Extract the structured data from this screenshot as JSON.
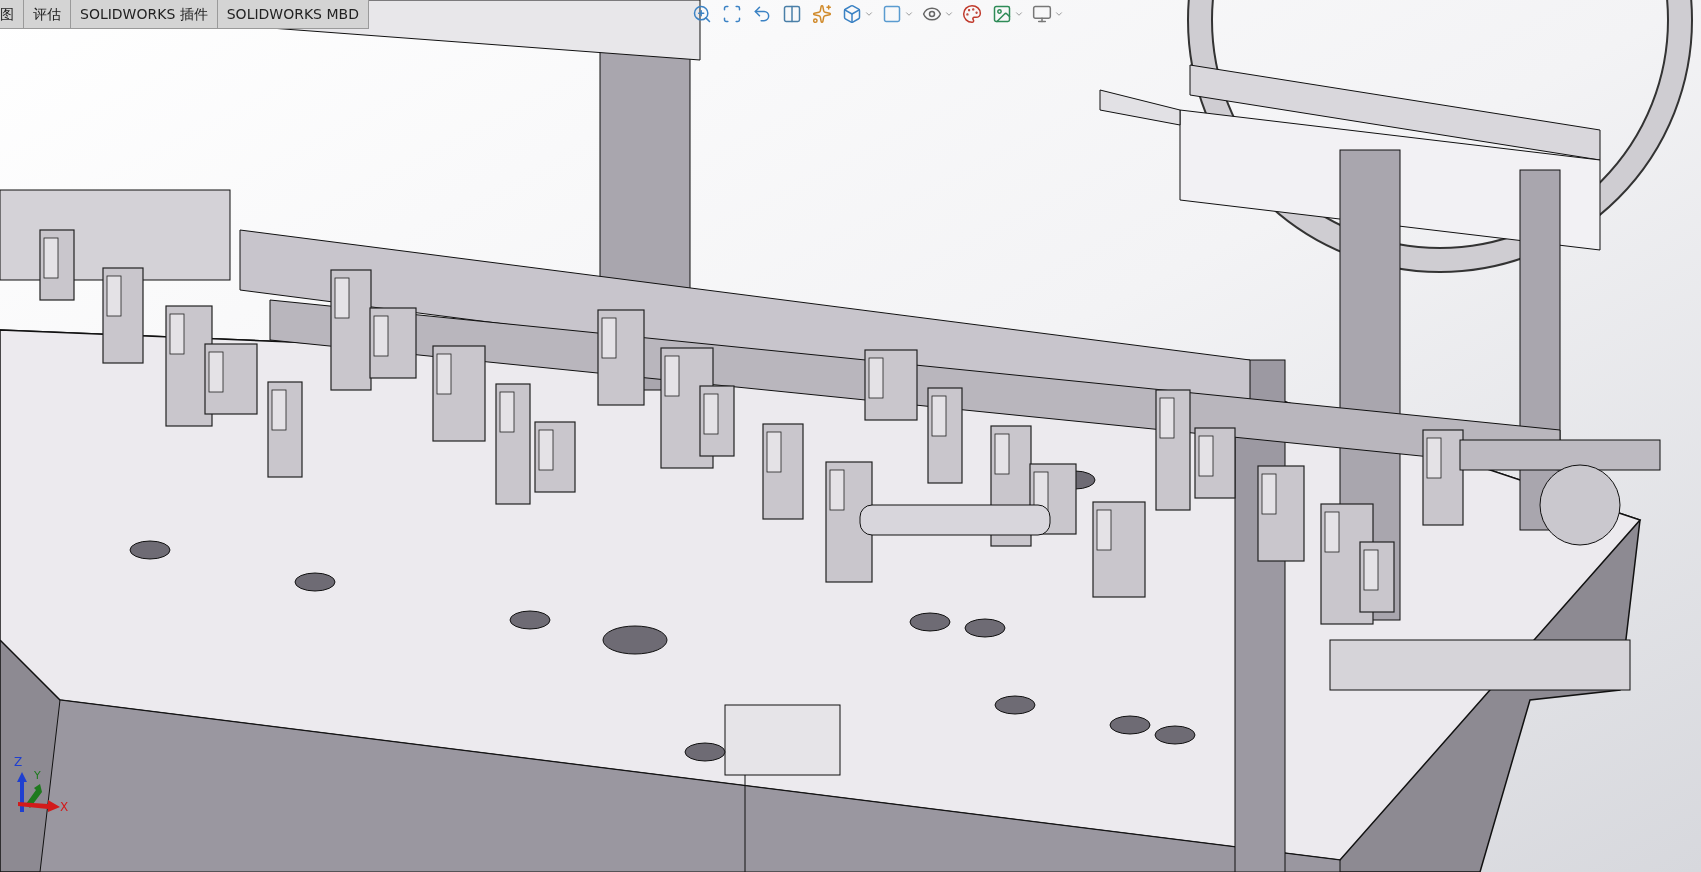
{
  "tabs": [
    {
      "label": "图"
    },
    {
      "label": "评估"
    },
    {
      "label": "SOLIDWORKS 插件"
    },
    {
      "label": "SOLIDWORKS MBD"
    }
  ],
  "view_toolbar": [
    {
      "kind": "zoom-fit",
      "dropdown": false
    },
    {
      "kind": "zoom-area",
      "dropdown": false
    },
    {
      "kind": "previous-view",
      "dropdown": false
    },
    {
      "kind": "section",
      "dropdown": false
    },
    {
      "kind": "annotation",
      "dropdown": false
    },
    {
      "kind": "orientation",
      "dropdown": true
    },
    {
      "kind": "display-style",
      "dropdown": true
    },
    {
      "kind": "hide-show",
      "dropdown": true
    },
    {
      "kind": "appearance",
      "dropdown": false
    },
    {
      "kind": "scene",
      "dropdown": true
    },
    {
      "kind": "view-settings",
      "dropdown": true
    }
  ],
  "triad": {
    "z": "Z",
    "y": "Y",
    "x": "X"
  }
}
